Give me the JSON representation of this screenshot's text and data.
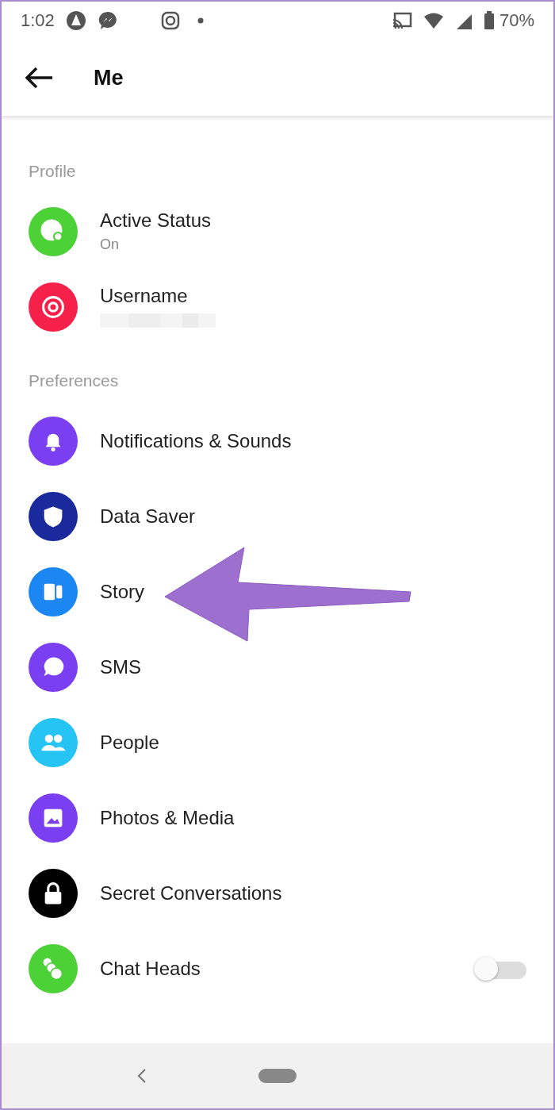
{
  "status_bar": {
    "time": "1:02",
    "battery": "70%"
  },
  "app_bar": {
    "title": "Me"
  },
  "sections": [
    {
      "header": "Profile",
      "items": [
        {
          "kind": "link",
          "label": "Active Status",
          "subtitle": "On",
          "color": "#4cd137"
        },
        {
          "kind": "redacted",
          "label": "Username",
          "color": "#f5214a"
        }
      ]
    },
    {
      "header": "Preferences",
      "items": [
        {
          "kind": "link",
          "label": "Notifications & Sounds",
          "color": "#7b3ff2"
        },
        {
          "kind": "link",
          "label": "Data Saver",
          "color": "#1a2a9c"
        },
        {
          "kind": "link",
          "label": "Story",
          "color": "#1c86f2"
        },
        {
          "kind": "link",
          "label": "SMS",
          "color": "#7b3ff2"
        },
        {
          "kind": "link",
          "label": "People",
          "color": "#25c4f5"
        },
        {
          "kind": "link",
          "label": "Photos & Media",
          "color": "#7b3ff2"
        },
        {
          "kind": "link",
          "label": "Secret Conversations",
          "color": "#000000"
        },
        {
          "kind": "toggle",
          "label": "Chat Heads",
          "on": false,
          "color": "#4cd137"
        }
      ]
    }
  ]
}
